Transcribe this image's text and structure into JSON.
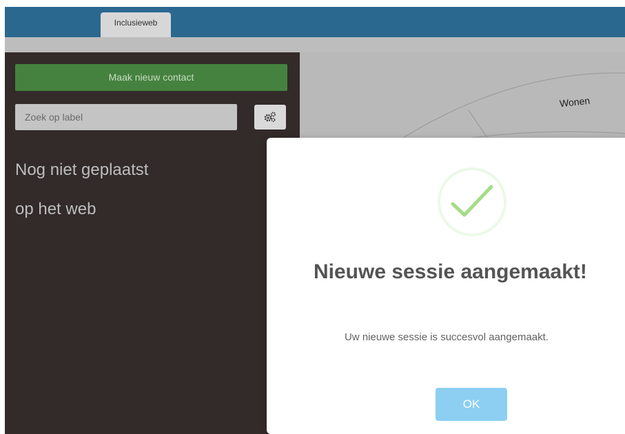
{
  "header": {
    "tabs": [
      {
        "label": "Inclusieweb",
        "active": true
      }
    ]
  },
  "sidebar": {
    "new_contact_label": "Maak nieuw contact",
    "search": {
      "placeholder": "Zoek op label",
      "value": ""
    },
    "settings_icon": "gears-icon",
    "not_placed_heading_line1": "Nog niet geplaatst",
    "not_placed_heading_line2": "op het web"
  },
  "web": {
    "segments": [
      "Wonen"
    ]
  },
  "modal": {
    "icon": "success-check-icon",
    "title": "Nieuwe sessie aangemaakt!",
    "message": "Uw nieuwe sessie is succesvol aangemaakt.",
    "ok_label": "OK"
  },
  "colors": {
    "header_bar": "#2a6890",
    "sidebar_bg": "#332a2a",
    "primary_green": "#45823f",
    "ok_button": "#8ccff2",
    "success_check": "#a5dc86"
  }
}
